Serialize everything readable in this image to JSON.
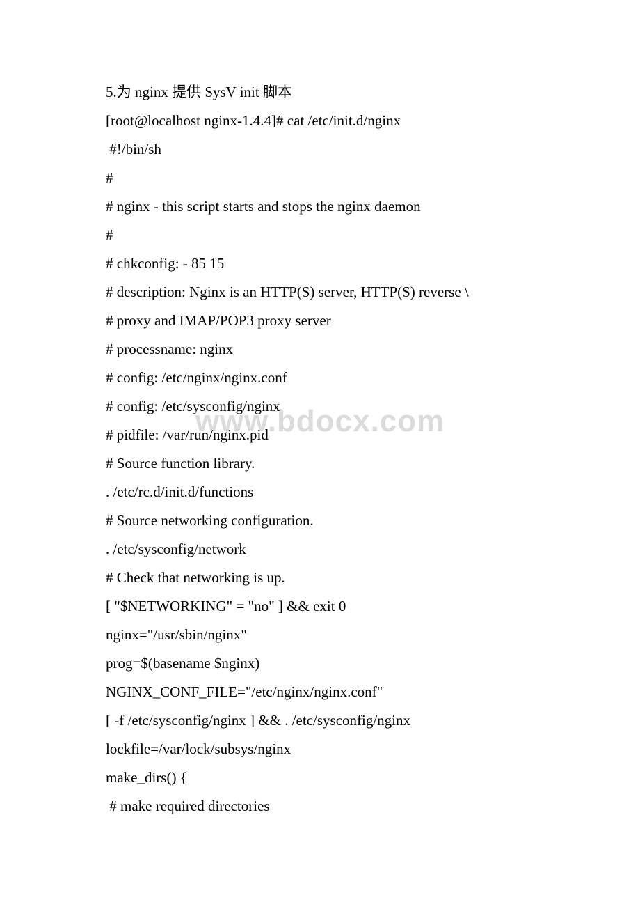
{
  "watermark": "www.bdocx.com",
  "lines": [
    "5.为 nginx 提供 SysV init 脚本",
    "[root@localhost nginx-1.4.4]# cat /etc/init.d/nginx",
    " #!/bin/sh",
    "#",
    "# nginx - this script starts and stops the nginx daemon",
    "#",
    "# chkconfig: - 85 15",
    "# description: Nginx is an HTTP(S) server, HTTP(S) reverse \\",
    "# proxy and IMAP/POP3 proxy server",
    "# processname: nginx",
    "# config: /etc/nginx/nginx.conf",
    "# config: /etc/sysconfig/nginx",
    "# pidfile: /var/run/nginx.pid",
    "# Source function library.",
    ". /etc/rc.d/init.d/functions",
    "# Source networking configuration.",
    ". /etc/sysconfig/network",
    "# Check that networking is up.",
    "[ \"$NETWORKING\" = \"no\" ] && exit 0",
    "nginx=\"/usr/sbin/nginx\"",
    "prog=$(basename $nginx)",
    "NGINX_CONF_FILE=\"/etc/nginx/nginx.conf\"",
    "[ -f /etc/sysconfig/nginx ] && . /etc/sysconfig/nginx",
    "lockfile=/var/lock/subsys/nginx",
    "make_dirs() {",
    " # make required directories"
  ]
}
